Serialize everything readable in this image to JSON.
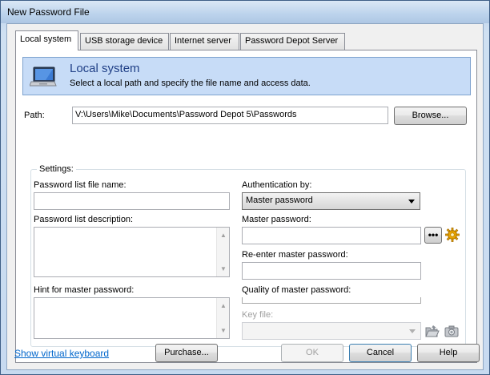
{
  "window": {
    "title": "New Password File"
  },
  "tabs": [
    {
      "label": "Local system"
    },
    {
      "label": "USB storage device"
    },
    {
      "label": "Internet server"
    },
    {
      "label": "Password Depot Server"
    }
  ],
  "banner": {
    "title": "Local system",
    "subtitle": "Select a local path and specify the file name and access data.",
    "icon": "monitor-icon"
  },
  "path": {
    "label": "Path:",
    "value": "V:\\Users\\Mike\\Documents\\Password Depot 5\\Passwords",
    "browse_label": "Browse..."
  },
  "settings": {
    "legend": "Settings:",
    "file_name_label": "Password list file name:",
    "file_name_value": "",
    "description_label": "Password list description:",
    "hint_label": "Hint for master password:",
    "auth_label": "Authentication by:",
    "auth_value": "Master password",
    "master_password_label": "Master password:",
    "reenter_label": "Re-enter master password:",
    "quality_label": "Quality of master password:",
    "quality_level": 0,
    "key_file_label": "Key file:",
    "key_file_value": ""
  },
  "icons": {
    "show_password": "more-dots-icon",
    "generate": "gear-icon",
    "open_key": "folder-open-icon",
    "capture_key": "camera-icon"
  },
  "footer": {
    "keyboard_link": "Show virtual keyboard",
    "purchase_label": "Purchase...",
    "ok_label": "OK",
    "cancel_label": "Cancel",
    "help_label": "Help"
  },
  "colors": {
    "banner_bg": "#c7dcf7",
    "banner_title": "#1f3f86",
    "link": "#0066cc"
  }
}
